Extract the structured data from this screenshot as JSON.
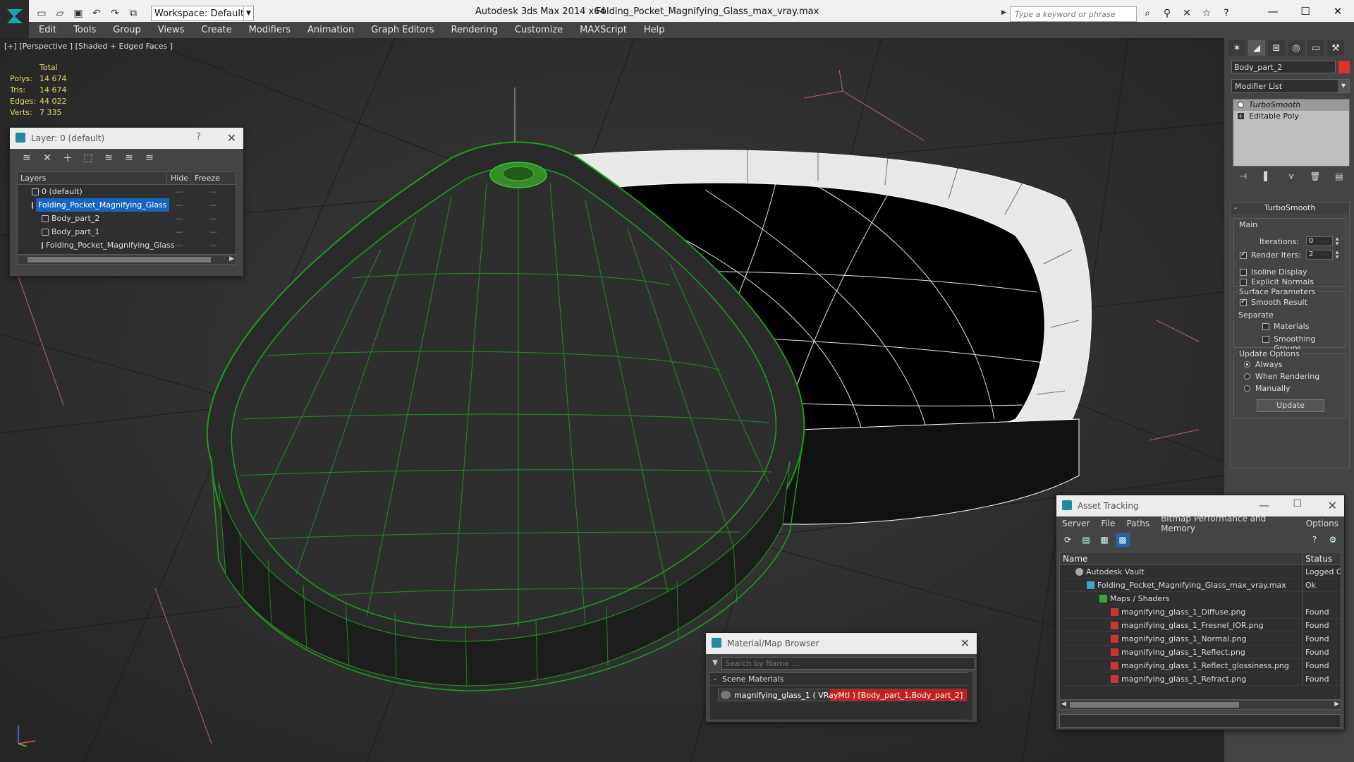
{
  "titlebar": {
    "workspace": "Workspace: Default",
    "app_title": "Autodesk 3ds Max  2014 x64",
    "file_title": "Folding_Pocket_Magnifying_Glass_max_vray.max",
    "search_placeholder": "Type a keyword or phrase"
  },
  "menu": [
    "Edit",
    "Tools",
    "Group",
    "Views",
    "Create",
    "Modifiers",
    "Animation",
    "Graph Editors",
    "Rendering",
    "Customize",
    "MAXScript",
    "Help"
  ],
  "viewport": {
    "label": "[+] [Perspective ] [Shaded + Edged Faces ]",
    "stats": {
      "header": "Total",
      "rows": [
        {
          "k": "Polys:",
          "v": "14 674"
        },
        {
          "k": "Tris:",
          "v": "14 674"
        },
        {
          "k": "Edges:",
          "v": "44 022"
        },
        {
          "k": "Verts:",
          "v": "7 335"
        }
      ]
    }
  },
  "layer_window": {
    "title": "Layer: 0 (default)",
    "help": "?",
    "columns": [
      "Layers",
      "Hide",
      "Freeze"
    ],
    "rows": [
      {
        "name": "0 (default)",
        "indent": 1,
        "selected": false
      },
      {
        "name": "Folding_Pocket_Magnifying_Glass",
        "indent": 1,
        "selected": true
      },
      {
        "name": "Body_part_2",
        "indent": 2,
        "selected": false
      },
      {
        "name": "Body_part_1",
        "indent": 2,
        "selected": false
      },
      {
        "name": "Folding_Pocket_Magnifying_Glass",
        "indent": 2,
        "selected": false
      }
    ]
  },
  "command_panel": {
    "object_name": "Body_part_2",
    "object_color": "#e03030",
    "modifier_list": "Modifier List",
    "stack": [
      "TurboSmooth",
      "Editable Poly"
    ],
    "rollout_title": "TurboSmooth",
    "main_label": "Main",
    "iterations_label": "Iterations:",
    "iterations_value": "0",
    "render_iters_label": "Render Iters:",
    "render_iters_value": "2",
    "isoline": "Isoline Display",
    "explicit_normals": "Explicit Normals",
    "surface_params": "Surface Parameters",
    "smooth_result": "Smooth Result",
    "separate": "Separate",
    "materials": "Materials",
    "smoothing_groups": "Smoothing Groups",
    "update_options": "Update Options",
    "always": "Always",
    "when_rendering": "When Rendering",
    "manually": "Manually",
    "update_button": "Update"
  },
  "material_browser": {
    "title": "Material/Map Browser",
    "search_placeholder": "Search by Name ...",
    "section": "Scene Materials",
    "item": "magnifying_glass_1  ( VRayMtl ) [Body_part_1,Body_part_2]"
  },
  "asset_tracking": {
    "title": "Asset Tracking",
    "menu": [
      "Server",
      "File",
      "Paths",
      "Bitmap Performance and Memory",
      "Options"
    ],
    "columns": [
      "Name",
      "Status"
    ],
    "rows": [
      {
        "name": "Autodesk Vault",
        "status": "Logged O",
        "indent": 1,
        "icon": "vault"
      },
      {
        "name": "Folding_Pocket_Magnifying_Glass_max_vray.max",
        "status": "Ok",
        "indent": 2,
        "icon": "max3"
      },
      {
        "name": "Maps / Shaders",
        "status": "",
        "indent": 3,
        "icon": "maps"
      },
      {
        "name": "magnifying_glass_1_Diffuse.png",
        "status": "Found",
        "indent": 4,
        "icon": "png"
      },
      {
        "name": "magnifying_glass_1_Fresnel_IOR.png",
        "status": "Found",
        "indent": 4,
        "icon": "png"
      },
      {
        "name": "magnifying_glass_1_Normal.png",
        "status": "Found",
        "indent": 4,
        "icon": "png"
      },
      {
        "name": "magnifying_glass_1_Reflect.png",
        "status": "Found",
        "indent": 4,
        "icon": "png"
      },
      {
        "name": "magnifying_glass_1_Reflect_glossiness.png",
        "status": "Found",
        "indent": 4,
        "icon": "png"
      },
      {
        "name": "magnifying_glass_1_Refract.png",
        "status": "Found",
        "indent": 4,
        "icon": "png"
      }
    ]
  }
}
